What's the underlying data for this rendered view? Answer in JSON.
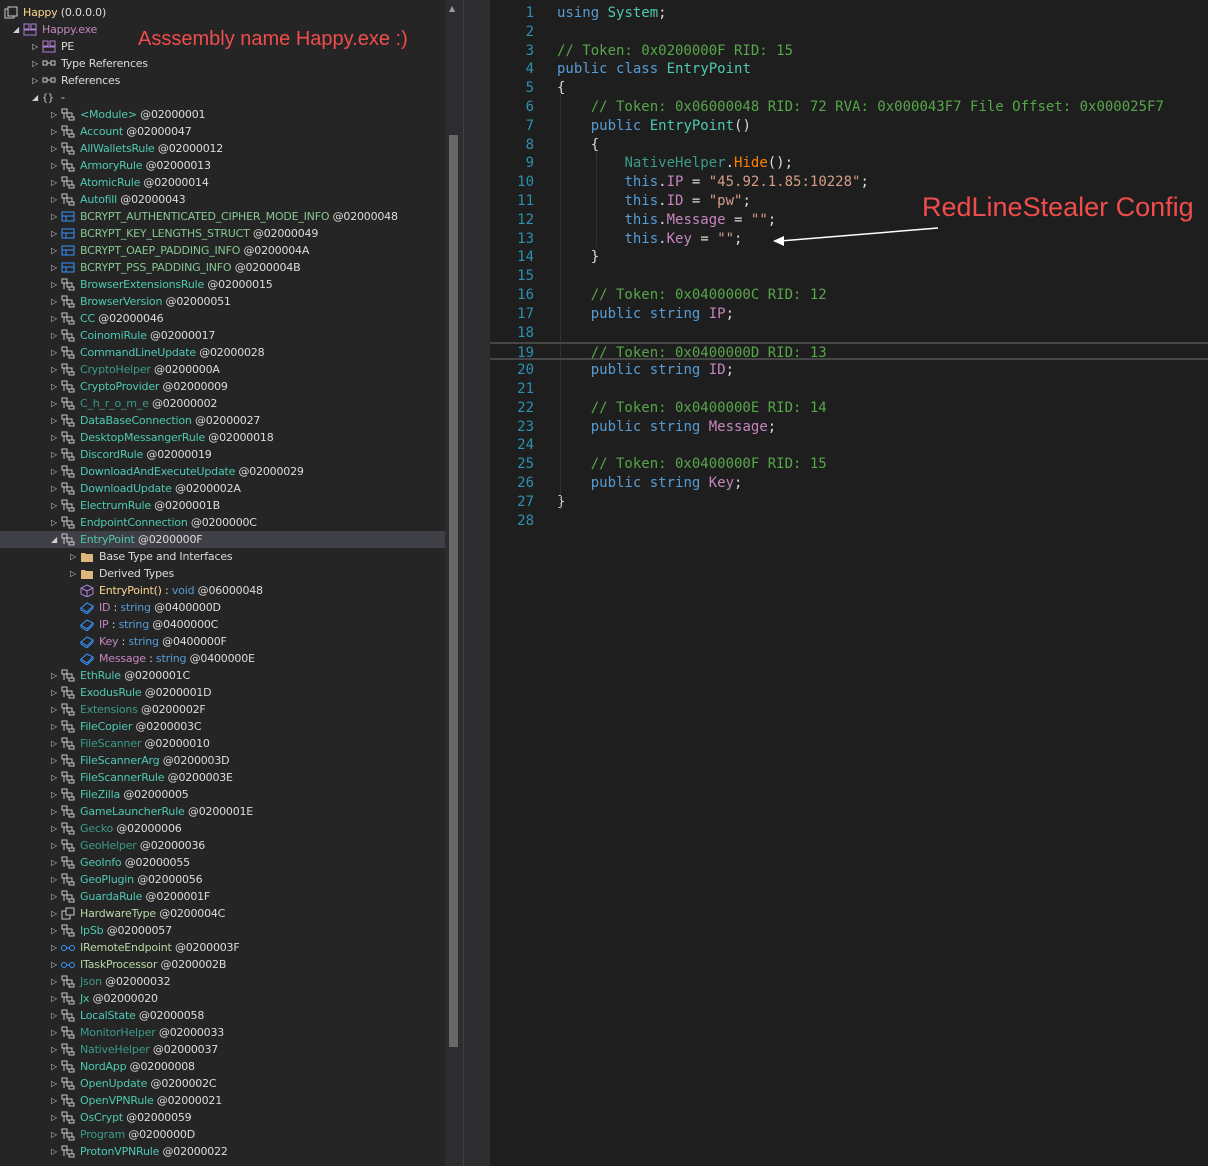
{
  "tree": {
    "nodes": [
      {
        "level": 0,
        "arrow": "",
        "icon": "assembly-list",
        "name": "Happy",
        "suffix": " (0.0.0.0)",
        "cls": "n-method"
      },
      {
        "level": 1,
        "arrow": "open",
        "icon": "assembly",
        "name": "Happy.exe",
        "suffix": "",
        "cls": "n-asm"
      },
      {
        "level": 2,
        "arrow": "closed",
        "icon": "pe",
        "name": "PE",
        "suffix": "",
        "cls": "n-plain"
      },
      {
        "level": 2,
        "arrow": "closed",
        "icon": "references",
        "name": "Type References",
        "suffix": "",
        "cls": "n-plain"
      },
      {
        "level": 2,
        "arrow": "closed",
        "icon": "references",
        "name": "References",
        "suffix": "",
        "cls": "n-plain"
      },
      {
        "level": 2,
        "arrow": "open",
        "icon": "namespace",
        "name": "-",
        "suffix": "",
        "cls": "n-plain"
      },
      {
        "level": 3,
        "arrow": "closed",
        "icon": "class",
        "name": "<Module>",
        "suffix": " @02000001",
        "cls": "n-class"
      },
      {
        "level": 3,
        "arrow": "closed",
        "icon": "class",
        "name": "Account",
        "suffix": " @02000047",
        "cls": "n-class"
      },
      {
        "level": 3,
        "arrow": "closed",
        "icon": "class",
        "name": "AllWalletsRule",
        "suffix": " @02000012",
        "cls": "n-class"
      },
      {
        "level": 3,
        "arrow": "closed",
        "icon": "class",
        "name": "ArmoryRule",
        "suffix": " @02000013",
        "cls": "n-class"
      },
      {
        "level": 3,
        "arrow": "closed",
        "icon": "class",
        "name": "AtomicRule",
        "suffix": " @02000014",
        "cls": "n-class"
      },
      {
        "level": 3,
        "arrow": "closed",
        "icon": "class",
        "name": "Autofill",
        "suffix": " @02000043",
        "cls": "n-class"
      },
      {
        "level": 3,
        "arrow": "closed",
        "icon": "struct",
        "name": "BCRYPT_AUTHENTICATED_CIPHER_MODE_INFO",
        "suffix": " @02000048",
        "cls": "n-struct"
      },
      {
        "level": 3,
        "arrow": "closed",
        "icon": "struct",
        "name": "BCRYPT_KEY_LENGTHS_STRUCT",
        "suffix": " @02000049",
        "cls": "n-struct"
      },
      {
        "level": 3,
        "arrow": "closed",
        "icon": "struct",
        "name": "BCRYPT_OAEP_PADDING_INFO",
        "suffix": " @0200004A",
        "cls": "n-struct"
      },
      {
        "level": 3,
        "arrow": "closed",
        "icon": "struct",
        "name": "BCRYPT_PSS_PADDING_INFO",
        "suffix": " @0200004B",
        "cls": "n-struct"
      },
      {
        "level": 3,
        "arrow": "closed",
        "icon": "class",
        "name": "BrowserExtensionsRule",
        "suffix": " @02000015",
        "cls": "n-class"
      },
      {
        "level": 3,
        "arrow": "closed",
        "icon": "class",
        "name": "BrowserVersion",
        "suffix": " @02000051",
        "cls": "n-class"
      },
      {
        "level": 3,
        "arrow": "closed",
        "icon": "class",
        "name": "CC",
        "suffix": " @02000046",
        "cls": "n-class"
      },
      {
        "level": 3,
        "arrow": "closed",
        "icon": "class",
        "name": "CoinomiRule",
        "suffix": " @02000017",
        "cls": "n-class"
      },
      {
        "level": 3,
        "arrow": "closed",
        "icon": "class",
        "name": "CommandLineUpdate",
        "suffix": " @02000028",
        "cls": "n-class"
      },
      {
        "level": 3,
        "arrow": "closed",
        "icon": "class",
        "name": "CryptoHelper",
        "suffix": " @0200000A",
        "cls": "n-static"
      },
      {
        "level": 3,
        "arrow": "closed",
        "icon": "class",
        "name": "CryptoProvider",
        "suffix": " @02000009",
        "cls": "n-class"
      },
      {
        "level": 3,
        "arrow": "closed",
        "icon": "class",
        "name": "C_h_r_o_m_e",
        "suffix": " @02000002",
        "cls": "n-static"
      },
      {
        "level": 3,
        "arrow": "closed",
        "icon": "class",
        "name": "DataBaseConnection",
        "suffix": " @02000027",
        "cls": "n-class"
      },
      {
        "level": 3,
        "arrow": "closed",
        "icon": "class",
        "name": "DesktopMessangerRule",
        "suffix": " @02000018",
        "cls": "n-class"
      },
      {
        "level": 3,
        "arrow": "closed",
        "icon": "class",
        "name": "DiscordRule",
        "suffix": " @02000019",
        "cls": "n-class"
      },
      {
        "level": 3,
        "arrow": "closed",
        "icon": "class",
        "name": "DownloadAndExecuteUpdate",
        "suffix": " @02000029",
        "cls": "n-class"
      },
      {
        "level": 3,
        "arrow": "closed",
        "icon": "class",
        "name": "DownloadUpdate",
        "suffix": " @0200002A",
        "cls": "n-class"
      },
      {
        "level": 3,
        "arrow": "closed",
        "icon": "class",
        "name": "ElectrumRule",
        "suffix": " @0200001B",
        "cls": "n-class"
      },
      {
        "level": 3,
        "arrow": "closed",
        "icon": "class",
        "name": "EndpointConnection",
        "suffix": " @0200000C",
        "cls": "n-class"
      },
      {
        "level": 3,
        "arrow": "open",
        "icon": "class",
        "name": "EntryPoint",
        "suffix": " @0200000F",
        "cls": "n-class",
        "selected": true
      },
      {
        "level": 4,
        "arrow": "closed",
        "icon": "folder",
        "name": "Base Type and Interfaces",
        "suffix": "",
        "cls": "n-plain"
      },
      {
        "level": 4,
        "arrow": "closed",
        "icon": "folder",
        "name": "Derived Types",
        "suffix": "",
        "cls": "n-plain"
      },
      {
        "level": 4,
        "arrow": "",
        "icon": "method",
        "name": "EntryPoint()",
        "suffix": " @06000048",
        "cls": "n-method",
        "type": "void"
      },
      {
        "level": 4,
        "arrow": "",
        "icon": "field",
        "name": "ID",
        "suffix": " @0400000D",
        "cls": "n-field",
        "type": "string"
      },
      {
        "level": 4,
        "arrow": "",
        "icon": "field",
        "name": "IP",
        "suffix": " @0400000C",
        "cls": "n-field",
        "type": "string"
      },
      {
        "level": 4,
        "arrow": "",
        "icon": "field",
        "name": "Key",
        "suffix": " @0400000F",
        "cls": "n-field",
        "type": "string"
      },
      {
        "level": 4,
        "arrow": "",
        "icon": "field",
        "name": "Message",
        "suffix": " @0400000E",
        "cls": "n-field",
        "type": "string"
      },
      {
        "level": 3,
        "arrow": "closed",
        "icon": "class",
        "name": "EthRule",
        "suffix": " @0200001C",
        "cls": "n-class"
      },
      {
        "level": 3,
        "arrow": "closed",
        "icon": "class",
        "name": "ExodusRule",
        "suffix": " @0200001D",
        "cls": "n-class"
      },
      {
        "level": 3,
        "arrow": "closed",
        "icon": "class",
        "name": "Extensions",
        "suffix": " @0200002F",
        "cls": "n-static"
      },
      {
        "level": 3,
        "arrow": "closed",
        "icon": "class",
        "name": "FileCopier",
        "suffix": " @0200003C",
        "cls": "n-class"
      },
      {
        "level": 3,
        "arrow": "closed",
        "icon": "class",
        "name": "FileScanner",
        "suffix": " @02000010",
        "cls": "n-static"
      },
      {
        "level": 3,
        "arrow": "closed",
        "icon": "class",
        "name": "FileScannerArg",
        "suffix": " @0200003D",
        "cls": "n-class"
      },
      {
        "level": 3,
        "arrow": "closed",
        "icon": "class",
        "name": "FileScannerRule",
        "suffix": " @0200003E",
        "cls": "n-class"
      },
      {
        "level": 3,
        "arrow": "closed",
        "icon": "class",
        "name": "FileZilla",
        "suffix": " @02000005",
        "cls": "n-class"
      },
      {
        "level": 3,
        "arrow": "closed",
        "icon": "class",
        "name": "GameLauncherRule",
        "suffix": " @0200001E",
        "cls": "n-class"
      },
      {
        "level": 3,
        "arrow": "closed",
        "icon": "class",
        "name": "Gecko",
        "suffix": " @02000006",
        "cls": "n-static"
      },
      {
        "level": 3,
        "arrow": "closed",
        "icon": "class",
        "name": "GeoHelper",
        "suffix": " @02000036",
        "cls": "n-static"
      },
      {
        "level": 3,
        "arrow": "closed",
        "icon": "class",
        "name": "GeoInfo",
        "suffix": " @02000055",
        "cls": "n-class"
      },
      {
        "level": 3,
        "arrow": "closed",
        "icon": "class",
        "name": "GeoPlugin",
        "suffix": " @02000056",
        "cls": "n-class"
      },
      {
        "level": 3,
        "arrow": "closed",
        "icon": "class",
        "name": "GuardaRule",
        "suffix": " @0200001F",
        "cls": "n-class"
      },
      {
        "level": 3,
        "arrow": "closed",
        "icon": "enum",
        "name": "HardwareType",
        "suffix": " @0200004C",
        "cls": "n-enum"
      },
      {
        "level": 3,
        "arrow": "closed",
        "icon": "class",
        "name": "IpSb",
        "suffix": " @02000057",
        "cls": "n-class"
      },
      {
        "level": 3,
        "arrow": "closed",
        "icon": "interface",
        "name": "IRemoteEndpoint",
        "suffix": " @0200003F",
        "cls": "n-iface"
      },
      {
        "level": 3,
        "arrow": "closed",
        "icon": "interface",
        "name": "ITaskProcessor",
        "suffix": " @0200002B",
        "cls": "n-iface"
      },
      {
        "level": 3,
        "arrow": "closed",
        "icon": "class",
        "name": "Json",
        "suffix": " @02000032",
        "cls": "n-static"
      },
      {
        "level": 3,
        "arrow": "closed",
        "icon": "class",
        "name": "Jx",
        "suffix": " @02000020",
        "cls": "n-class"
      },
      {
        "level": 3,
        "arrow": "closed",
        "icon": "class",
        "name": "LocalState",
        "suffix": " @02000058",
        "cls": "n-class"
      },
      {
        "level": 3,
        "arrow": "closed",
        "icon": "class",
        "name": "MonitorHelper",
        "suffix": " @02000033",
        "cls": "n-static"
      },
      {
        "level": 3,
        "arrow": "closed",
        "icon": "class",
        "name": "NativeHelper",
        "suffix": " @02000037",
        "cls": "n-static"
      },
      {
        "level": 3,
        "arrow": "closed",
        "icon": "class",
        "name": "NordApp",
        "suffix": " @02000008",
        "cls": "n-class"
      },
      {
        "level": 3,
        "arrow": "closed",
        "icon": "class",
        "name": "OpenUpdate",
        "suffix": " @0200002C",
        "cls": "n-class"
      },
      {
        "level": 3,
        "arrow": "closed",
        "icon": "class",
        "name": "OpenVPNRule",
        "suffix": " @02000021",
        "cls": "n-class"
      },
      {
        "level": 3,
        "arrow": "closed",
        "icon": "class",
        "name": "OsCrypt",
        "suffix": " @02000059",
        "cls": "n-class"
      },
      {
        "level": 3,
        "arrow": "closed",
        "icon": "class",
        "name": "Program",
        "suffix": " @0200000D",
        "cls": "n-static"
      },
      {
        "level": 3,
        "arrow": "closed",
        "icon": "class",
        "name": "ProtonVPNRule",
        "suffix": " @02000022",
        "cls": "n-class"
      }
    ],
    "annotation": "Asssembly name Happy.exe :)"
  },
  "editor": {
    "annotation": "RedLineStealer Config",
    "lines": [
      [
        [
          "kw",
          "using"
        ],
        [
          "plain",
          " "
        ],
        [
          "type",
          "System"
        ],
        [
          "plain",
          ";"
        ]
      ],
      [],
      [
        [
          "com",
          "// Token: 0x0200000F RID: 15"
        ]
      ],
      [
        [
          "kw",
          "public"
        ],
        [
          "plain",
          " "
        ],
        [
          "kw",
          "class"
        ],
        [
          "plain",
          " "
        ],
        [
          "type",
          "EntryPoint"
        ]
      ],
      [
        [
          "plain",
          "{"
        ]
      ],
      [
        [
          "plain",
          "    "
        ],
        [
          "com",
          "// Token: 0x06000048 RID: 72 RVA: 0x000043F7 File Offset: 0x000025F7"
        ]
      ],
      [
        [
          "plain",
          "    "
        ],
        [
          "kw",
          "public"
        ],
        [
          "plain",
          " "
        ],
        [
          "type",
          "EntryPoint"
        ],
        [
          "plain",
          "()"
        ]
      ],
      [
        [
          "plain",
          "    {"
        ]
      ],
      [
        [
          "plain",
          "        "
        ],
        [
          "static",
          "NativeHelper"
        ],
        [
          "plain",
          "."
        ],
        [
          "meth",
          "Hide"
        ],
        [
          "plain",
          "();"
        ]
      ],
      [
        [
          "plain",
          "        "
        ],
        [
          "kw",
          "this"
        ],
        [
          "plain",
          "."
        ],
        [
          "prop",
          "IP"
        ],
        [
          "plain",
          " = "
        ],
        [
          "str",
          "\"45.92.1.85:10228\""
        ],
        [
          "plain",
          ";"
        ]
      ],
      [
        [
          "plain",
          "        "
        ],
        [
          "kw",
          "this"
        ],
        [
          "plain",
          "."
        ],
        [
          "prop",
          "ID"
        ],
        [
          "plain",
          " = "
        ],
        [
          "str",
          "\"pw\""
        ],
        [
          "plain",
          ";"
        ]
      ],
      [
        [
          "plain",
          "        "
        ],
        [
          "kw",
          "this"
        ],
        [
          "plain",
          "."
        ],
        [
          "prop",
          "Message"
        ],
        [
          "plain",
          " = "
        ],
        [
          "str",
          "\"\""
        ],
        [
          "plain",
          ";"
        ]
      ],
      [
        [
          "plain",
          "        "
        ],
        [
          "kw",
          "this"
        ],
        [
          "plain",
          "."
        ],
        [
          "prop",
          "Key"
        ],
        [
          "plain",
          " = "
        ],
        [
          "str",
          "\"\""
        ],
        [
          "plain",
          ";"
        ]
      ],
      [
        [
          "plain",
          "    }"
        ]
      ],
      [],
      [
        [
          "plain",
          "    "
        ],
        [
          "com",
          "// Token: 0x0400000C RID: 12"
        ]
      ],
      [
        [
          "plain",
          "    "
        ],
        [
          "kw",
          "public"
        ],
        [
          "plain",
          " "
        ],
        [
          "kw",
          "string"
        ],
        [
          "plain",
          " "
        ],
        [
          "prop",
          "IP"
        ],
        [
          "plain",
          ";"
        ]
      ],
      [],
      [
        [
          "plain",
          "    "
        ],
        [
          "com",
          "// Token: 0x0400000D RID: 13"
        ]
      ],
      [
        [
          "plain",
          "    "
        ],
        [
          "kw",
          "public"
        ],
        [
          "plain",
          " "
        ],
        [
          "kw",
          "string"
        ],
        [
          "plain",
          " "
        ],
        [
          "prop",
          "ID"
        ],
        [
          "plain",
          ";"
        ]
      ],
      [],
      [
        [
          "plain",
          "    "
        ],
        [
          "com",
          "// Token: 0x0400000E RID: 14"
        ]
      ],
      [
        [
          "plain",
          "    "
        ],
        [
          "kw",
          "public"
        ],
        [
          "plain",
          " "
        ],
        [
          "kw",
          "string"
        ],
        [
          "plain",
          " "
        ],
        [
          "prop",
          "Message"
        ],
        [
          "plain",
          ";"
        ]
      ],
      [],
      [
        [
          "plain",
          "    "
        ],
        [
          "com",
          "// Token: 0x0400000F RID: 15"
        ]
      ],
      [
        [
          "plain",
          "    "
        ],
        [
          "kw",
          "public"
        ],
        [
          "plain",
          " "
        ],
        [
          "kw",
          "string"
        ],
        [
          "plain",
          " "
        ],
        [
          "prop",
          "Key"
        ],
        [
          "plain",
          ";"
        ]
      ],
      [
        [
          "plain",
          "}"
        ]
      ],
      []
    ],
    "line_numbers": [
      "1",
      "2",
      "3",
      "4",
      "5",
      "6",
      "7",
      "8",
      "9",
      "10",
      "11",
      "12",
      "13",
      "14",
      "15",
      "16",
      "17",
      "18",
      "19",
      "20",
      "21",
      "22",
      "23",
      "24",
      "25",
      "26",
      "27",
      "28"
    ],
    "current_line": 19
  }
}
